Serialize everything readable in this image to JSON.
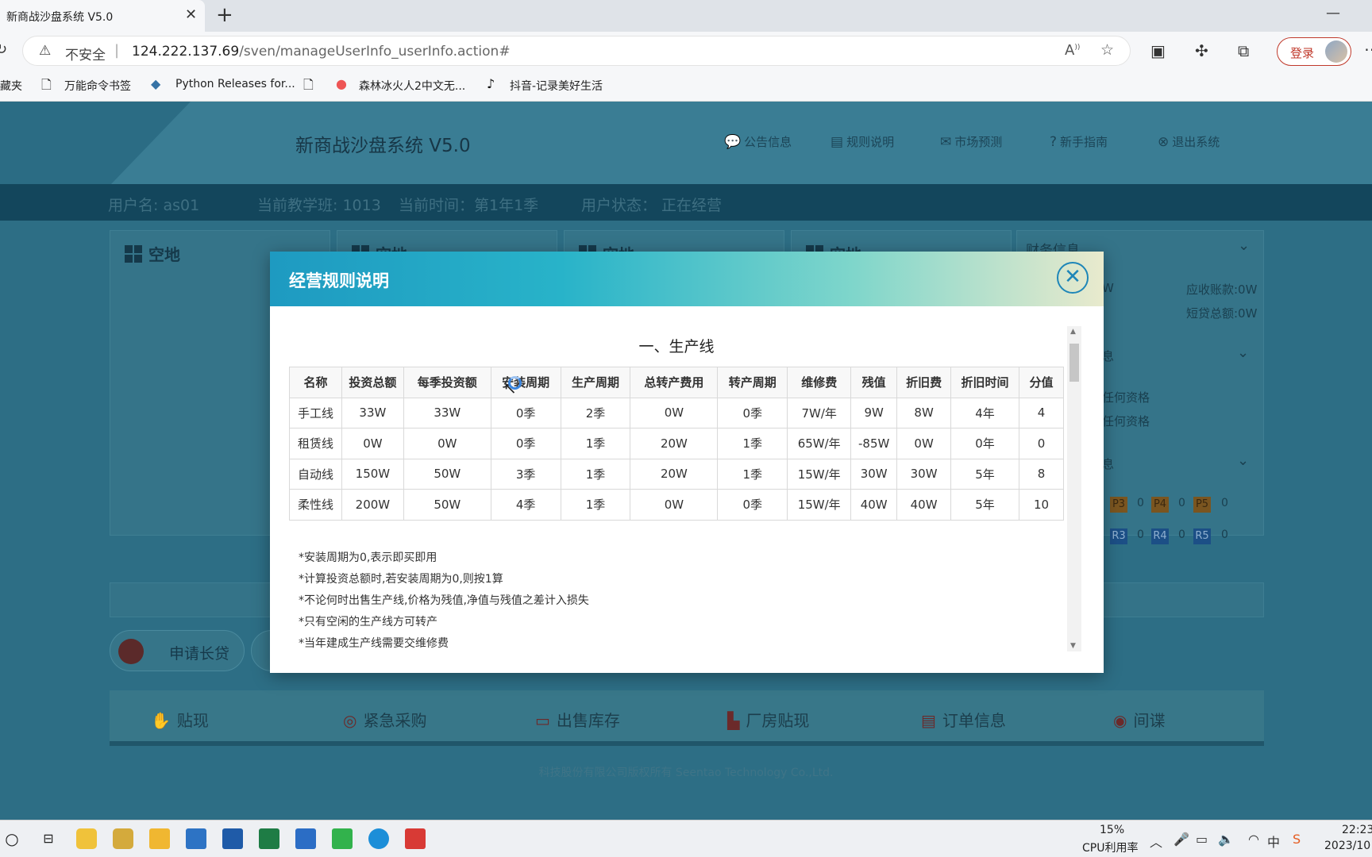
{
  "browser": {
    "tab_title": "新商战沙盘系统 V5.0",
    "tab_close": "✕",
    "new_tab": "+",
    "minimize": "—",
    "insecure_label": "不安全",
    "separator": "|",
    "url_host": "124.222.137.69",
    "url_path": "/sven/manageUserInfo_userInfo.action#",
    "login_label": "登录",
    "bookmarks": [
      "藏夹",
      "万能命令书签",
      "Python Releases for...",
      "森林冰火人2中文无...",
      "抖音-记录美好生活"
    ]
  },
  "app": {
    "title": "新商战沙盘系统 V5.0",
    "nav": [
      "公告信息",
      "规则说明",
      "市场预测",
      "新手指南",
      "退出系统"
    ],
    "status": {
      "user": "用户名: as01",
      "class": "当前教学班: 1013",
      "time": "当前时间：第1年1季",
      "state": "用户状态：  正在经营"
    },
    "cards": [
      "空地",
      "空地",
      "空地",
      "空地"
    ],
    "finance_title": "财务信息",
    "finance": {
      "receivable": "应收账款:0W",
      "short_loan": "短贷总额:0W",
      "w_fragment": "W"
    },
    "side_fragments": [
      "息",
      "任何资格",
      "任何资格",
      "息"
    ],
    "products_top": [
      {
        "label": "P3",
        "count": "0"
      },
      {
        "label": "P4",
        "count": "0"
      },
      {
        "label": "P5",
        "count": "0"
      }
    ],
    "products_bottom": [
      {
        "label": "R3",
        "count": "0"
      },
      {
        "label": "R4",
        "count": "0"
      },
      {
        "label": "R5",
        "count": "0"
      }
    ],
    "loan_button": "申请长贷",
    "actions": [
      "贴现",
      "紧急采购",
      "出售库存",
      "厂房贴现",
      "订单信息",
      "间谍"
    ],
    "copyright": "科技股份有限公司版权所有 Seentao Technology Co.,Ltd."
  },
  "modal": {
    "title": "经营规则说明",
    "close": "✕",
    "section_title": "一、生产线",
    "table": {
      "headers": [
        "名称",
        "投资总额",
        "每季投资额",
        "安装周期",
        "生产周期",
        "总转产费用",
        "转产周期",
        "维修费",
        "残值",
        "折旧费",
        "折旧时间",
        "分值"
      ],
      "rows": [
        [
          "手工线",
          "33W",
          "33W",
          "0季",
          "2季",
          "0W",
          "0季",
          "7W/年",
          "9W",
          "8W",
          "4年",
          "4"
        ],
        [
          "租赁线",
          "0W",
          "0W",
          "0季",
          "1季",
          "20W",
          "1季",
          "65W/年",
          "-85W",
          "0W",
          "0年",
          "0"
        ],
        [
          "自动线",
          "150W",
          "50W",
          "3季",
          "1季",
          "20W",
          "1季",
          "15W/年",
          "30W",
          "30W",
          "5年",
          "8"
        ],
        [
          "柔性线",
          "200W",
          "50W",
          "4季",
          "1季",
          "0W",
          "0季",
          "15W/年",
          "40W",
          "40W",
          "5年",
          "10"
        ]
      ]
    },
    "notes": [
      "*安装周期为0,表示即买即用",
      "*计算投资总额时,若安装周期为0,则按1算",
      "*不论何时出售生产线,价格为残值,净值与残值之差计入损失",
      "*只有空闲的生产线方可转产",
      "*当年建成生产线需要交维修费"
    ]
  },
  "taskbar": {
    "cpu_percent": "15%",
    "cpu_label": "CPU利用率",
    "ime": "中",
    "time": "22:23",
    "date": "2023/10"
  }
}
